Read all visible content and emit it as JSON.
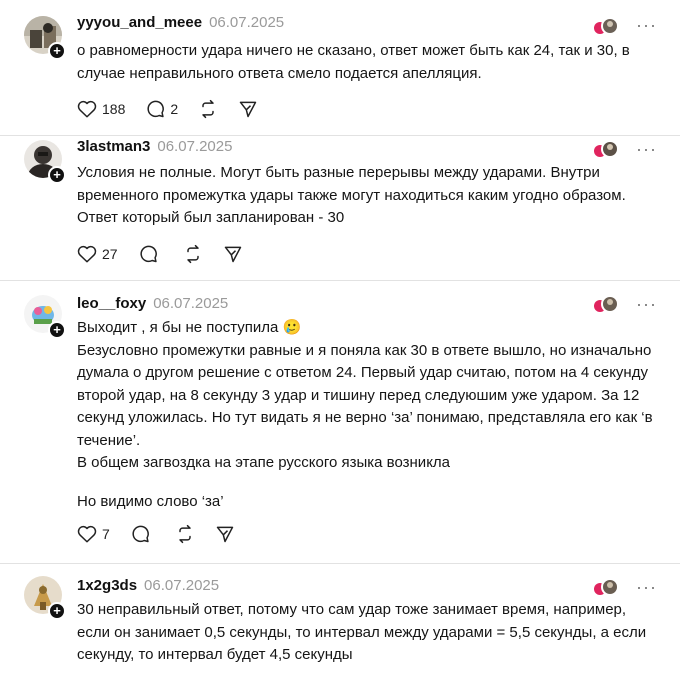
{
  "posts": [
    {
      "username": "yyyou_and_meee",
      "date": "06.07.2025",
      "paragraphs": [
        "о равномерности удара ничего не сказано, ответ может быть как 24, так и 30, в случае неправильного ответа смело подается апелляция."
      ],
      "likes": "188",
      "replies": "2"
    },
    {
      "username": "3lastman3",
      "date": "06.07.2025",
      "paragraphs": [
        "Условия не полные. Могут быть разные перерывы между ударами. Внутри временного промежутка удары также могут находиться каким угодно образом. Ответ который был запланирован - 30"
      ],
      "likes": "27",
      "replies": ""
    },
    {
      "username": "leo__foxy",
      "date": "06.07.2025",
      "paragraphs": [
        "Выходит , я бы не поступила 🥲\nБезусловно промежутки равные и я поняла как 30 в ответе вышло, но изначально думала о другом решение с ответом 24. Первый удар считаю, потом на 4 секунду второй удар, на 8 секунду 3 удар и тишину перед следуюшим уже ударом. За 12 секунд уложилась. Но тут видать я не верно ‘за’ понимаю, представляла его как ‘в течение’.\nВ общем загвоздка на этапе русского языка возникла",
        "Но видимо слово ‘за’"
      ],
      "likes": "7",
      "replies": ""
    },
    {
      "username": "1x2g3ds",
      "date": "06.07.2025",
      "paragraphs": [
        "30 неправильный ответ, потому что сам удар тоже занимает время, например, если он занимает 0,5 секунды, то интервал между ударами = 5,5 секунды, а если секунду, то интервал будет 4,5 секунды"
      ],
      "likes": "",
      "replies": ""
    }
  ],
  "icons": {
    "like": "heart-icon",
    "reply": "comment-bubble-icon",
    "repost": "repost-icon",
    "share": "send-icon",
    "more": "more-dots-icon",
    "follow": "plus-icon"
  },
  "ui": {
    "more_glyph": "···",
    "plus_glyph": "+"
  },
  "colors": {
    "text": "#151515",
    "muted": "#9a9a9a",
    "divider": "#e2e2e2",
    "like_heart": "#e0245e"
  }
}
